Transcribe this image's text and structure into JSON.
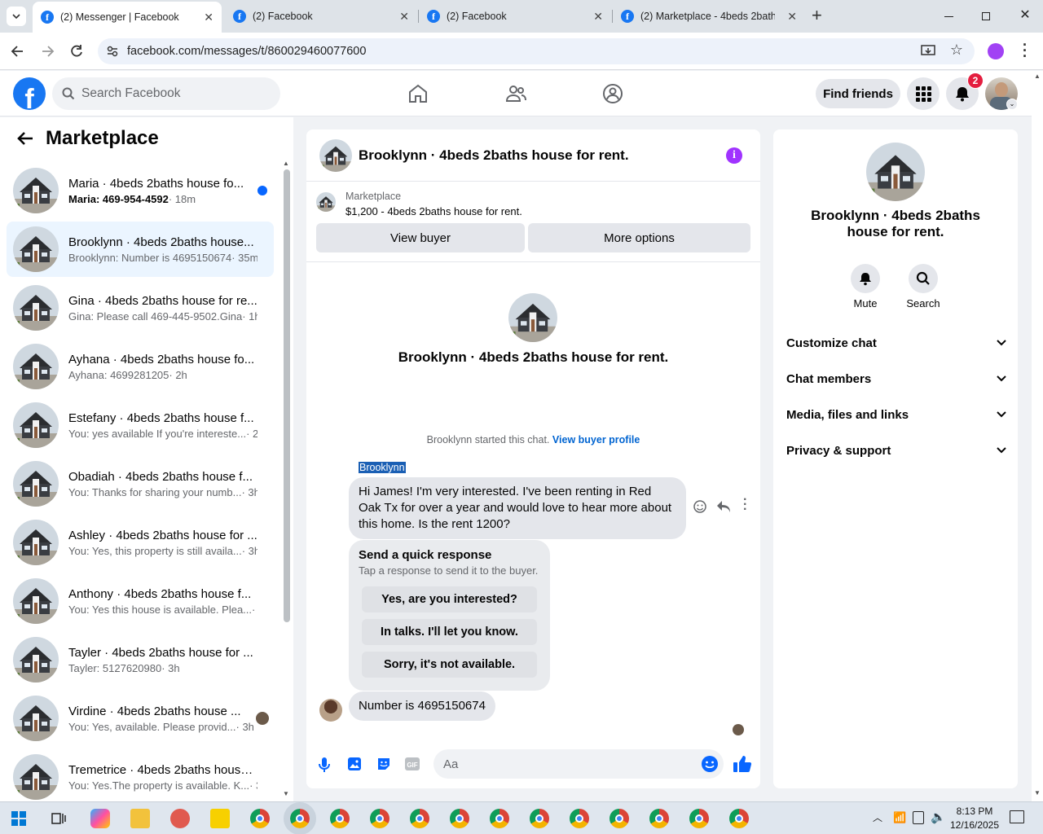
{
  "browser": {
    "tabs": [
      {
        "title": "(2) Messenger | Facebook",
        "active": true
      },
      {
        "title": "(2) Facebook",
        "active": false
      },
      {
        "title": "(2) Facebook",
        "active": false
      },
      {
        "title": "(2) Marketplace - 4beds 2baths",
        "active": false
      }
    ],
    "url": "facebook.com/messages/t/860029460077600"
  },
  "header": {
    "search_placeholder": "Search Facebook",
    "find_friends": "Find friends",
    "notification_count": "2"
  },
  "sidebar": {
    "title": "Marketplace",
    "conversations": [
      {
        "title": "Maria · 4beds 2baths house fo...",
        "preview": "Maria: 469-954-4592",
        "time": "· 18m",
        "unread": true
      },
      {
        "title": "Brooklynn · 4beds 2baths house...",
        "preview": "Brooklynn: Number is 4695150674",
        "time": "· 35m",
        "active": true
      },
      {
        "title": "Gina · 4beds 2baths house for re...",
        "preview": "Gina: Please call 469-445-9502.Gina",
        "time": "· 1h"
      },
      {
        "title": "Ayhana · 4beds 2baths house fo...",
        "preview": "Ayhana: 4699281205",
        "time": "· 2h"
      },
      {
        "title": "Estefany · 4beds 2baths house f...",
        "preview": "You: yes available If you're intereste...",
        "time": "· 2h"
      },
      {
        "title": "Obadiah · 4beds 2baths house f...",
        "preview": "You: Thanks for sharing your numb...",
        "time": "· 3h"
      },
      {
        "title": "Ashley · 4beds 2baths house for ...",
        "preview": "You: Yes, this property is still availa...",
        "time": "· 3h"
      },
      {
        "title": "Anthony · 4beds 2baths house f...",
        "preview": "You: Yes this house is available. Plea...",
        "time": "· 3h"
      },
      {
        "title": "Tayler · 4beds 2baths house for ...",
        "preview": "Tayler: 5127620980",
        "time": "· 3h"
      },
      {
        "title": "Virdine · 4beds 2baths house ...",
        "preview": "You: Yes, available. Please provid...",
        "time": "· 3h"
      },
      {
        "title": "Tremetrice · 4beds 2baths house...",
        "preview": "You: Yes.The property is available. K...",
        "time": "· 3h"
      }
    ]
  },
  "chat": {
    "title": "Brooklynn · 4beds 2baths house for rent.",
    "listing_label": "Marketplace",
    "listing_price": "$1,200 - 4beds 2baths house for rent.",
    "view_buyer": "View buyer",
    "more_options": "More options",
    "intro_name": "Brooklynn · 4beds 2baths house for rent.",
    "started_text": "Brooklynn started this chat.",
    "view_buyer_profile": "View buyer profile",
    "sender_name": "Brooklynn",
    "message1": "Hi James! I'm very interested. I've been renting in Red Oak Tx for over a year and would love to hear more about this home. Is the rent 1200?",
    "quick_title": "Send a quick response",
    "quick_sub": "Tap a response to send it to the buyer.",
    "quick_responses": [
      "Yes, are you interested?",
      "In talks. I'll let you know.",
      "Sorry, it's not available."
    ],
    "message2": "Number is 4695150674",
    "input_placeholder": "Aa"
  },
  "info": {
    "name": "Brooklynn · 4beds 2baths house for rent.",
    "mute": "Mute",
    "search": "Search",
    "sections": [
      "Customize chat",
      "Chat members",
      "Media, files and links",
      "Privacy & support"
    ]
  },
  "taskbar": {
    "time": "8:13 PM",
    "date": "12/16/2025"
  },
  "colors": {
    "facebook_blue": "#1877f2",
    "messenger_blue": "#0866ff",
    "info_purple": "#a033ff"
  }
}
